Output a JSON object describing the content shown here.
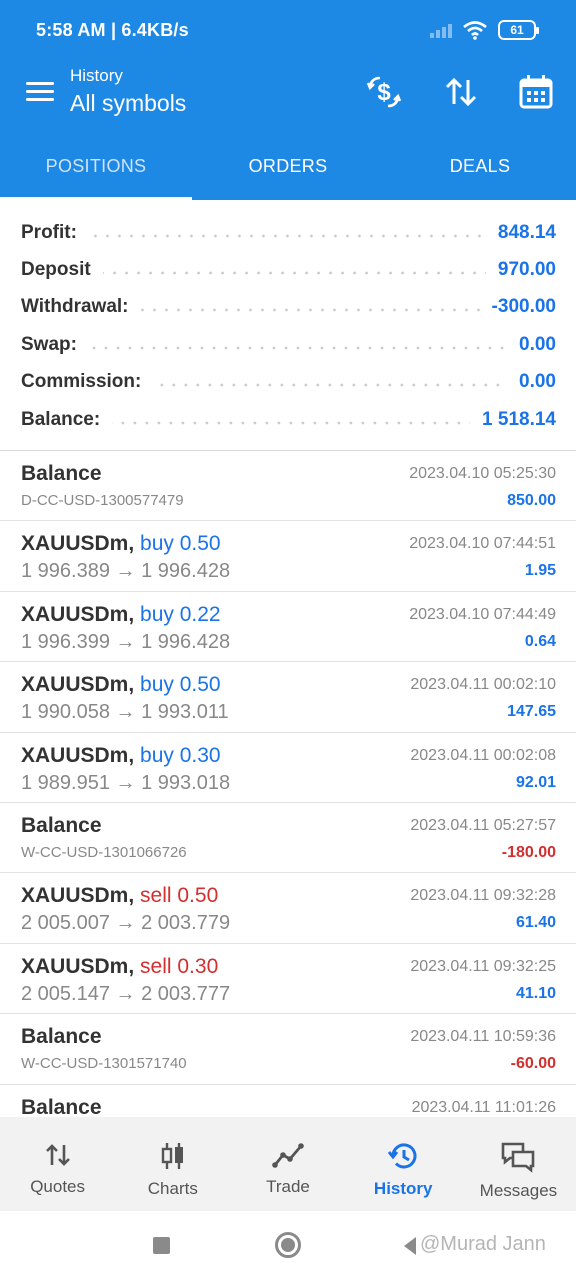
{
  "status_bar": {
    "time_speed": "5:58 AM | 6.4KB/s",
    "battery": "61"
  },
  "app_bar": {
    "subtitle": "History",
    "title": "All symbols"
  },
  "tabs": [
    {
      "label": "POSITIONS",
      "active": true
    },
    {
      "label": "ORDERS",
      "active": false
    },
    {
      "label": "DEALS",
      "active": false
    }
  ],
  "summary": [
    {
      "label": "Profit:",
      "value": "848.14"
    },
    {
      "label": "Deposit",
      "value": "970.00"
    },
    {
      "label": "Withdrawal:",
      "value": "-300.00"
    },
    {
      "label": "Swap:",
      "value": "0.00"
    },
    {
      "label": "Commission:",
      "value": "0.00"
    },
    {
      "label": "Balance:",
      "value": "1 518.14"
    }
  ],
  "deals": [
    {
      "symbol": "Balance",
      "side": "",
      "detail": "D-CC-USD-1300577479",
      "time": "2023.04.10 05:25:30",
      "amount": "850.00",
      "amount_type": "pos"
    },
    {
      "symbol": "XAUUSDm,",
      "side": "buy 0.50",
      "side_type": "buy",
      "detail": "1 996.389 → 1 996.428",
      "time": "2023.04.10 07:44:51",
      "amount": "1.95",
      "amount_type": "pos"
    },
    {
      "symbol": "XAUUSDm,",
      "side": "buy 0.22",
      "side_type": "buy",
      "detail": "1 996.399 → 1 996.428",
      "time": "2023.04.10 07:44:49",
      "amount": "0.64",
      "amount_type": "pos"
    },
    {
      "symbol": "XAUUSDm,",
      "side": "buy 0.50",
      "side_type": "buy",
      "detail": "1 990.058 → 1 993.011",
      "time": "2023.04.11 00:02:10",
      "amount": "147.65",
      "amount_type": "pos"
    },
    {
      "symbol": "XAUUSDm,",
      "side": "buy 0.30",
      "side_type": "buy",
      "detail": "1 989.951 → 1 993.018",
      "time": "2023.04.11 00:02:08",
      "amount": "92.01",
      "amount_type": "pos"
    },
    {
      "symbol": "Balance",
      "side": "",
      "detail": "W-CC-USD-1301066726",
      "time": "2023.04.11 05:27:57",
      "amount": "-180.00",
      "amount_type": "neg"
    },
    {
      "symbol": "XAUUSDm,",
      "side": "sell 0.50",
      "side_type": "sell",
      "detail": "2 005.007 → 2 003.779",
      "time": "2023.04.11 09:32:28",
      "amount": "61.40",
      "amount_type": "pos"
    },
    {
      "symbol": "XAUUSDm,",
      "side": "sell 0.30",
      "side_type": "sell",
      "detail": "2 005.147 → 2 003.777",
      "time": "2023.04.11 09:32:25",
      "amount": "41.10",
      "amount_type": "pos"
    },
    {
      "symbol": "Balance",
      "side": "",
      "detail": "W-CC-USD-1301571740",
      "time": "2023.04.11 10:59:36",
      "amount": "-60.00",
      "amount_type": "neg"
    },
    {
      "symbol": "Balance",
      "side": "",
      "detail": "",
      "time": "2023.04.11 11:01:26",
      "amount": "",
      "amount_type": "pos"
    }
  ],
  "bottom_nav": [
    {
      "label": "Quotes",
      "icon": "quotes-arrows-icon",
      "active": false
    },
    {
      "label": "Charts",
      "icon": "candlestick-icon",
      "active": false
    },
    {
      "label": "Trade",
      "icon": "trade-line-icon",
      "active": false
    },
    {
      "label": "History",
      "icon": "history-clock-icon",
      "active": true
    },
    {
      "label": "Messages",
      "icon": "messages-icon",
      "active": false
    }
  ],
  "watermark": "@Murad Jann",
  "colors": {
    "primary": "#1e88e5",
    "positive": "#1a73e8",
    "negative": "#d32f2f"
  }
}
